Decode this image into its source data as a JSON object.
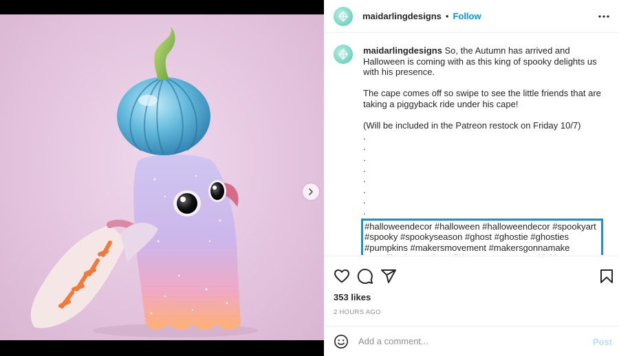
{
  "post": {
    "username": "maidarlingdesigns",
    "separator": "•",
    "follow_label": "Follow",
    "more_icon": "more-options-icon",
    "caption": {
      "username": "maidarlingdesigns",
      "line1": "So, the Autumn has arrived and Halloween is coming with as this king of spooky delights us with his presence.",
      "line2": "The cape comes off so swipe to see the little friends that are taking a piggyback ride under his cape!",
      "line3": "(Will be included in the Patreon restock on Friday 10/7)",
      "dots": [
        ".",
        ".",
        ".",
        ".",
        ".",
        ".",
        ".",
        "."
      ],
      "hashtags": "#halloweendecor #halloween #halloweendecor #spookyart #spooky #spookyseason #ghost #ghostie #ghosties #pumpkins #makersmovement #makersgonnamake #smallbusiness #kawaiiclay #cuteart #pumpkinking #figurines #miniature",
      "age": "2h"
    },
    "likes": "353 likes",
    "posted": "2 HOURS AGO",
    "comment": {
      "placeholder": "Add a comment...",
      "post_label": "Post"
    },
    "icons": [
      "heart-icon",
      "comment-icon",
      "share-icon",
      "bookmark-icon",
      "emoji-icon",
      "chevron-right-icon"
    ],
    "colors": {
      "follow": "#0095f6",
      "post_disabled": "#b2dffc",
      "highlight_border": "#1d8fd0",
      "avatar": "#6fd3c0"
    }
  }
}
